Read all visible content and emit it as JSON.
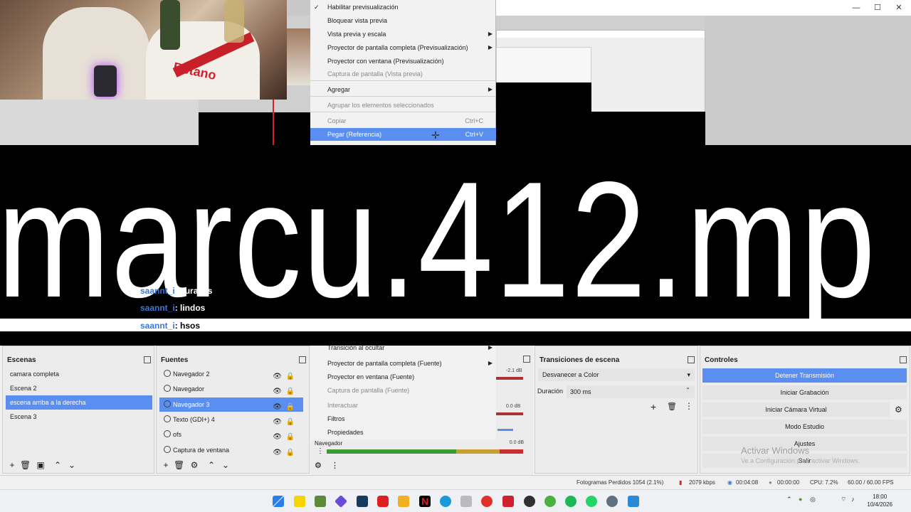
{
  "context_menu_top": {
    "items": [
      {
        "label": "Habilitar previsualización",
        "checked": true,
        "disabled": false
      },
      {
        "label": "Bloquear vista previa",
        "disabled": false
      },
      {
        "label": "Vista previa y escala",
        "submenu": true
      },
      {
        "label": "Proyector de pantalla completa (Previsualización)",
        "submenu": true
      },
      {
        "label": "Proyector con ventana (Previsualización)"
      },
      {
        "label": "Captura de pantalla (Vista previa)",
        "disabled": true
      },
      {
        "label": "Agregar",
        "submenu": true
      },
      {
        "label": "Agrupar los elementos seleccionados",
        "disabled": true
      },
      {
        "label": "Copiar",
        "shortcut": "Ctrl+C",
        "disabled": true
      },
      {
        "label": "Pegar (Referencia)",
        "shortcut": "Ctrl+V",
        "active": true
      }
    ]
  },
  "context_menu_bottom": {
    "items": [
      {
        "label": "Transición al ocultar",
        "submenu": true
      },
      {
        "label": "Proyector de pantalla completa (Fuente)",
        "submenu": true
      },
      {
        "label": "Proyector en ventana (Fuente)"
      },
      {
        "label": "Captura de pantalla (Fuente)",
        "disabled": true
      },
      {
        "label": "Interactuar",
        "disabled": true
      },
      {
        "label": "Filtros"
      },
      {
        "label": "Propiedades"
      }
    ]
  },
  "banner": {
    "text": "marcu.412.mp"
  },
  "chat": [
    {
      "user": "saannt_i",
      "msg": ": aurasss"
    },
    {
      "user": "saannt_i",
      "msg": ": lindos"
    },
    {
      "user": "saannt_i",
      "msg": ": hsos"
    }
  ],
  "scenes": {
    "title": "Escenas",
    "items": [
      "camara completa",
      "Escena 2",
      "escena arriba a la derecha",
      "Escena 3"
    ],
    "selected_index": 2
  },
  "sources": {
    "title": "Fuentes",
    "items": [
      {
        "label": "Navegador 2",
        "icon": "browser-icon"
      },
      {
        "label": "Navegador",
        "icon": "browser-icon"
      },
      {
        "label": "Navegador 3",
        "icon": "browser-icon",
        "selected": true
      },
      {
        "label": "Texto (GDI+) 4",
        "icon": "text-icon"
      },
      {
        "label": "ofs",
        "icon": "image-icon"
      },
      {
        "label": "Captura de ventana",
        "icon": "window-icon"
      }
    ]
  },
  "mixer": {
    "levels": [
      "-2.1 dB",
      "0.0 dB",
      "0.0 dB"
    ],
    "bottom_label": "Navegador",
    "bottom_level": "0.0 dB"
  },
  "transitions": {
    "title": "Transiciones de escena",
    "selected": "Desvanecer a Color",
    "duration_label": "Duración",
    "duration": "300 ms"
  },
  "controls": {
    "title": "Controles",
    "buttons": [
      "Detener Transmisión",
      "Iniciar Grabación",
      "Iniciar Cámara Virtual",
      "Modo Estudio",
      "Ajustes",
      "Salir"
    ]
  },
  "watermark": {
    "title": "Activar Windows",
    "subtitle": "Ve a Configuración para activar Windows."
  },
  "status": {
    "dropped": "Fotogramas Perdidos 1054 (2.1%)",
    "bitrate": "2079 kbps",
    "stream_time": "00:04:08",
    "rec_time": "00:00:00",
    "cpu": "CPU: 7.2%",
    "fps": "60.00 / 60.00 FPS"
  },
  "clock": {
    "time": "18:00",
    "date": "10/4/2026"
  },
  "colors": {
    "accent": "#5a8ef0",
    "chat_user": "#3a78d8"
  }
}
